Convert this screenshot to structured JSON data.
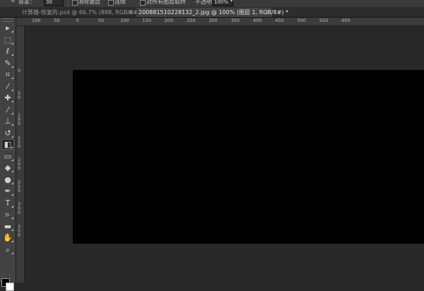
{
  "options_bar": {
    "tool_icon": "brush-tool-icon",
    "size_label": "容差：",
    "size_value": "30",
    "antialias_label": "消除锯齿",
    "contiguous_label": "连续",
    "all_layers_label": "对所有图层取样",
    "opacity_label": "不透明度：",
    "opacity_value": "100%"
  },
  "tabs": [
    {
      "title": "计算器-恢复的.psd @ 66.7% (888, RGB/8#)",
      "active": false
    },
    {
      "title": "200881510228132_2.jpg @ 100% (图层 1, RGB/8#) *",
      "active": true
    }
  ],
  "tools": [
    {
      "name": "move-tool-icon",
      "glyph": "▸"
    },
    {
      "name": "marquee-tool-icon",
      "glyph": "⬚"
    },
    {
      "name": "lasso-tool-icon",
      "glyph": "ℓ"
    },
    {
      "name": "quick-select-tool-icon",
      "glyph": "✎"
    },
    {
      "name": "crop-tool-icon",
      "glyph": "⌗"
    },
    {
      "name": "eyedropper-tool-icon",
      "glyph": "⁄"
    },
    {
      "name": "healing-brush-tool-icon",
      "glyph": "✚"
    },
    {
      "name": "brush-tool-icon",
      "glyph": "⁄"
    },
    {
      "name": "clone-stamp-tool-icon",
      "glyph": "⊥"
    },
    {
      "name": "history-brush-tool-icon",
      "glyph": "↺"
    },
    {
      "name": "eraser-tool-icon",
      "glyph": "◧"
    },
    {
      "name": "gradient-tool-icon",
      "glyph": "▭"
    },
    {
      "name": "blur-tool-icon",
      "glyph": "◆"
    },
    {
      "name": "dodge-tool-icon",
      "glyph": "●"
    },
    {
      "name": "pen-tool-icon",
      "glyph": "✒"
    },
    {
      "name": "type-tool-icon",
      "glyph": "T"
    },
    {
      "name": "path-select-tool-icon",
      "glyph": "▹"
    },
    {
      "name": "shape-tool-icon",
      "glyph": "▬"
    },
    {
      "name": "hand-tool-icon",
      "glyph": "✋"
    },
    {
      "name": "zoom-tool-icon",
      "glyph": "⌕"
    }
  ],
  "selected_tool_index": 10,
  "ruler_top_labels": [
    "100",
    "50",
    "0",
    "50",
    "100",
    "150",
    "200",
    "250",
    "300",
    "350",
    "400",
    "450",
    "500",
    "550",
    "600"
  ],
  "ruler_left_labels": [
    "0",
    "5 0",
    "1 0 0",
    "1 5 0",
    "2 0 0",
    "2 5 0",
    "3 0 0",
    "3 5 0"
  ],
  "colors": {
    "foreground": "#000000",
    "background": "#ffffff",
    "document": "#000000"
  }
}
